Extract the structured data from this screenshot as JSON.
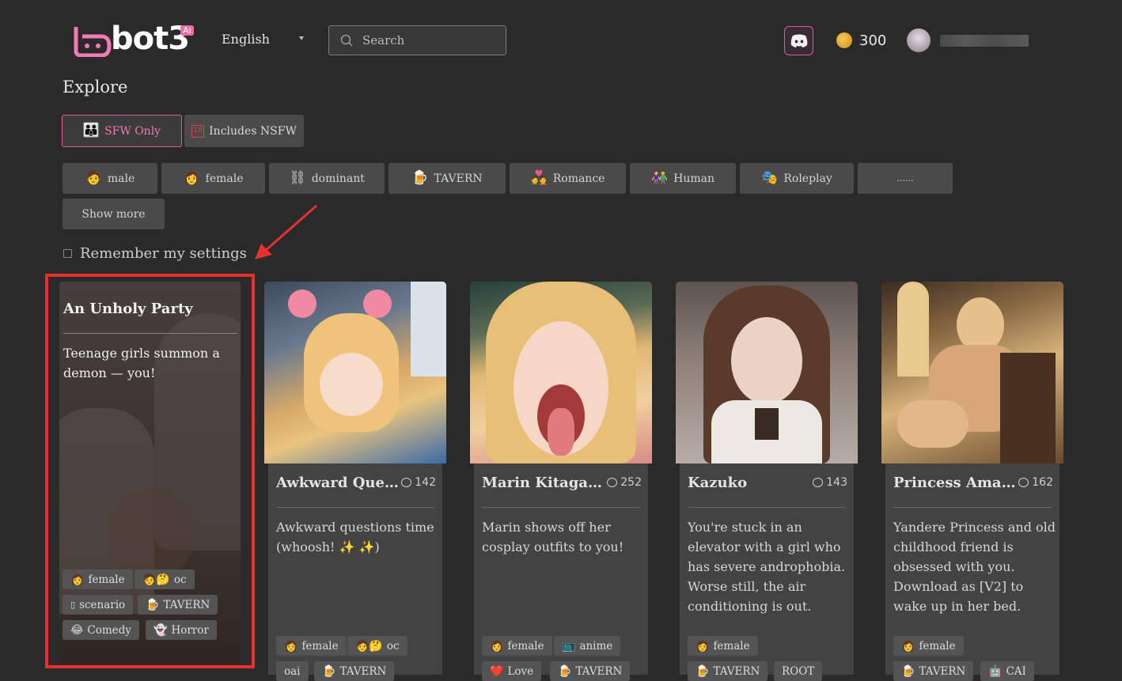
{
  "header": {
    "logo_text": "bot3",
    "logo_badge": "Ai",
    "language": "English",
    "search_placeholder": "Search",
    "coins": "300"
  },
  "explore": {
    "title": "Explore",
    "sfw_label": "SFW Only",
    "nsfw_label": "Includes NSFW",
    "tags": [
      {
        "emoji": "🧑",
        "label": "male"
      },
      {
        "emoji": "👩",
        "label": "female"
      },
      {
        "emoji": "⛓",
        "label": "dominant"
      },
      {
        "emoji": "🍺",
        "label": "TAVERN"
      },
      {
        "emoji": "💑",
        "label": "Romance"
      },
      {
        "emoji": "👫",
        "label": "Human"
      },
      {
        "emoji": "🎭",
        "label": "Roleplay"
      },
      {
        "emoji": "",
        "label": "......"
      }
    ],
    "show_more": "Show more",
    "remember": "Remember my settings"
  },
  "featured": {
    "title": "An Unholy Party",
    "description": "Teenage girls summon a demon — you!",
    "tags": [
      {
        "emoji": "👩",
        "label": "female"
      },
      {
        "emoji": "🧑🤔",
        "label": "oc"
      },
      {
        "emoji": "▯",
        "label": "scenario"
      },
      {
        "emoji": "🍺",
        "label": "TAVERN"
      },
      {
        "emoji": "😂",
        "label": "Comedy"
      },
      {
        "emoji": "👻",
        "label": "Horror"
      }
    ]
  },
  "cards": [
    {
      "name": "Awkward Quest…",
      "count": "142",
      "description": "Awkward questions time (whoosh! ✨ ✨)",
      "tags": [
        {
          "emoji": "👩",
          "label": "female"
        },
        {
          "emoji": "🧑🤔",
          "label": "oc"
        },
        {
          "emoji": "",
          "label": "oai"
        },
        {
          "emoji": "🍺",
          "label": "TAVERN"
        }
      ]
    },
    {
      "name": "Marin Kitagawa",
      "count": "252",
      "description": "Marin shows off her cosplay outfits to you!",
      "tags": [
        {
          "emoji": "👩",
          "label": "female"
        },
        {
          "emoji": "📺",
          "label": "anime"
        },
        {
          "emoji": "❤️",
          "label": "Love"
        },
        {
          "emoji": "🍺",
          "label": "TAVERN"
        }
      ]
    },
    {
      "name": "Kazuko",
      "count": "143",
      "description": "You're stuck in an elevator with a girl who has severe androphobia. Worse still, the air conditioning is out.",
      "tags": [
        {
          "emoji": "👩",
          "label": "female"
        },
        {
          "emoji": "🍺",
          "label": "TAVERN"
        },
        {
          "emoji": "",
          "label": "ROOT"
        }
      ]
    },
    {
      "name": "Princess Amalia…",
      "count": "162",
      "description": "Yandere Princess and old childhood friend is obsessed with you. Download as [V2] to wake up in her bed.",
      "tags": [
        {
          "emoji": "👩",
          "label": "female"
        },
        {
          "emoji": "🍺",
          "label": "TAVERN"
        },
        {
          "emoji": "🤖",
          "label": "CAI"
        }
      ]
    }
  ],
  "colors": {
    "background": "#2b2a2b",
    "accent_pink": "#e35a9e",
    "highlight_red": "#e5322e",
    "button_grey": "#4a4a4a"
  }
}
